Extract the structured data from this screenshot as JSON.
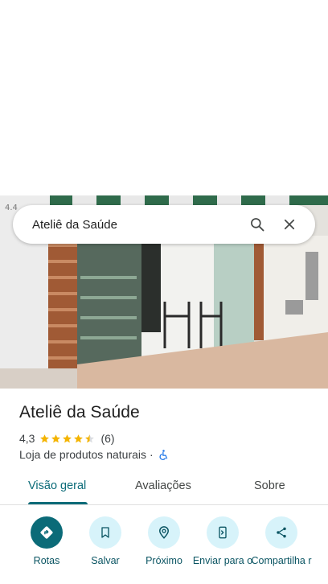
{
  "search": {
    "query": "Ateliê da Saúde",
    "search_icon": "search-icon",
    "close_icon": "close-icon"
  },
  "place": {
    "name": "Ateliê da Saúde",
    "rating": "4,3",
    "stars_value": 4.3,
    "review_count": "(6)",
    "category": "Loja de produtos naturais",
    "separator": "·"
  },
  "tabs": [
    {
      "label": "Visão geral",
      "active": true
    },
    {
      "label": "Avaliações",
      "active": false
    },
    {
      "label": "Sobre",
      "active": false
    }
  ],
  "actions": [
    {
      "label": "Rotas",
      "icon": "directions-icon"
    },
    {
      "label": "Salvar",
      "icon": "bookmark-icon"
    },
    {
      "label": "Próximo",
      "icon": "nearby-icon"
    },
    {
      "label": "Enviar para o",
      "icon": "send-to-phone-icon"
    },
    {
      "label": "Compartilha r",
      "icon": "share-icon"
    }
  ],
  "colors": {
    "accent": "#0b6b78",
    "action_bg": "#d7f3fa",
    "star": "#f4b400"
  }
}
